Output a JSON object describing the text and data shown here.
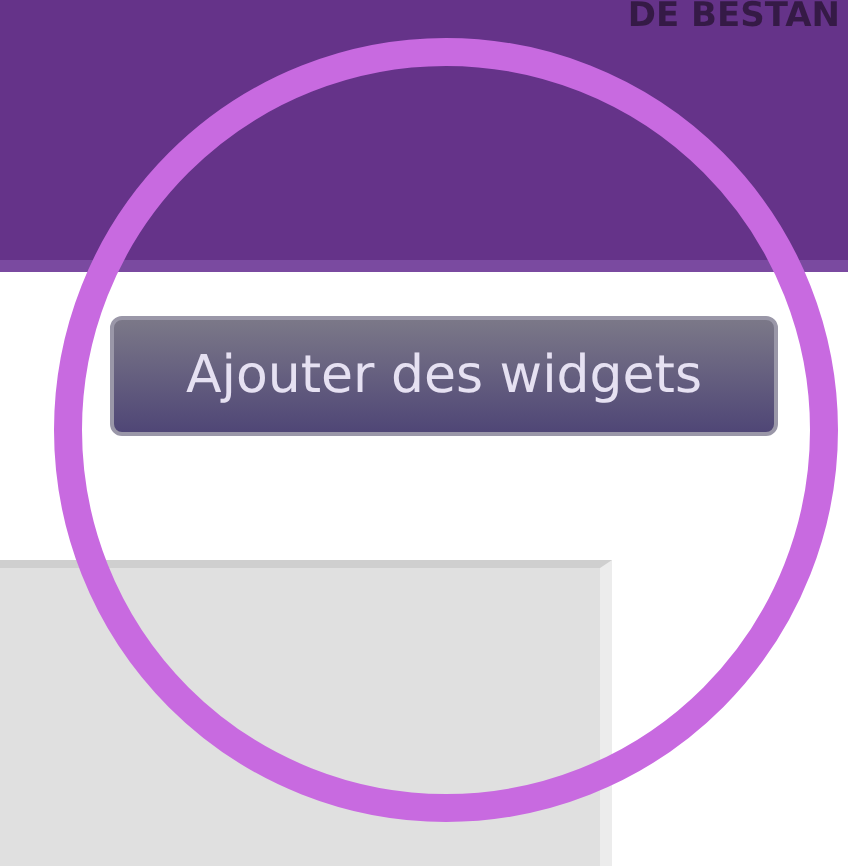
{
  "header": {
    "title": "DE BESTAN"
  },
  "toolbar": {
    "button": "Ajouter des widgets"
  },
  "annotation": {
    "kind": "circle",
    "color": "#c86ae0"
  }
}
